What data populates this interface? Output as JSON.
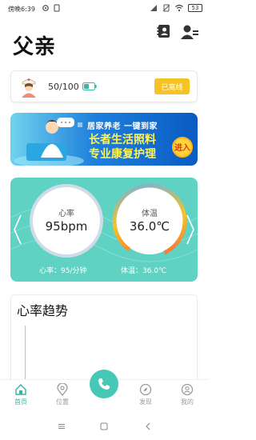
{
  "status_bar": {
    "time": "傍晚6:39",
    "battery": "53"
  },
  "header": {
    "title": "父亲"
  },
  "device": {
    "count": "50/100",
    "status_label": "已离线"
  },
  "banner": {
    "line1": "居家养老 一键到家",
    "line2": "长者生活照料",
    "line3": "专业康复护理",
    "enter_label": "进入"
  },
  "vitals": {
    "heart_rate_label": "心率",
    "heart_rate_value": "95bpm",
    "temperature_label": "体温",
    "temperature_value": "36.0℃",
    "heart_rate_text": "心率：95/分钟",
    "temperature_text": "体温：36.0℃"
  },
  "trend": {
    "title": "心率趋势"
  },
  "nav": {
    "home": "首页",
    "location": "位置",
    "discover": "发现",
    "mine": "我的"
  },
  "colors": {
    "accent": "#3ab6a4",
    "vitals_bg": "#5fd2c4",
    "offline_button": "#f6c324"
  }
}
